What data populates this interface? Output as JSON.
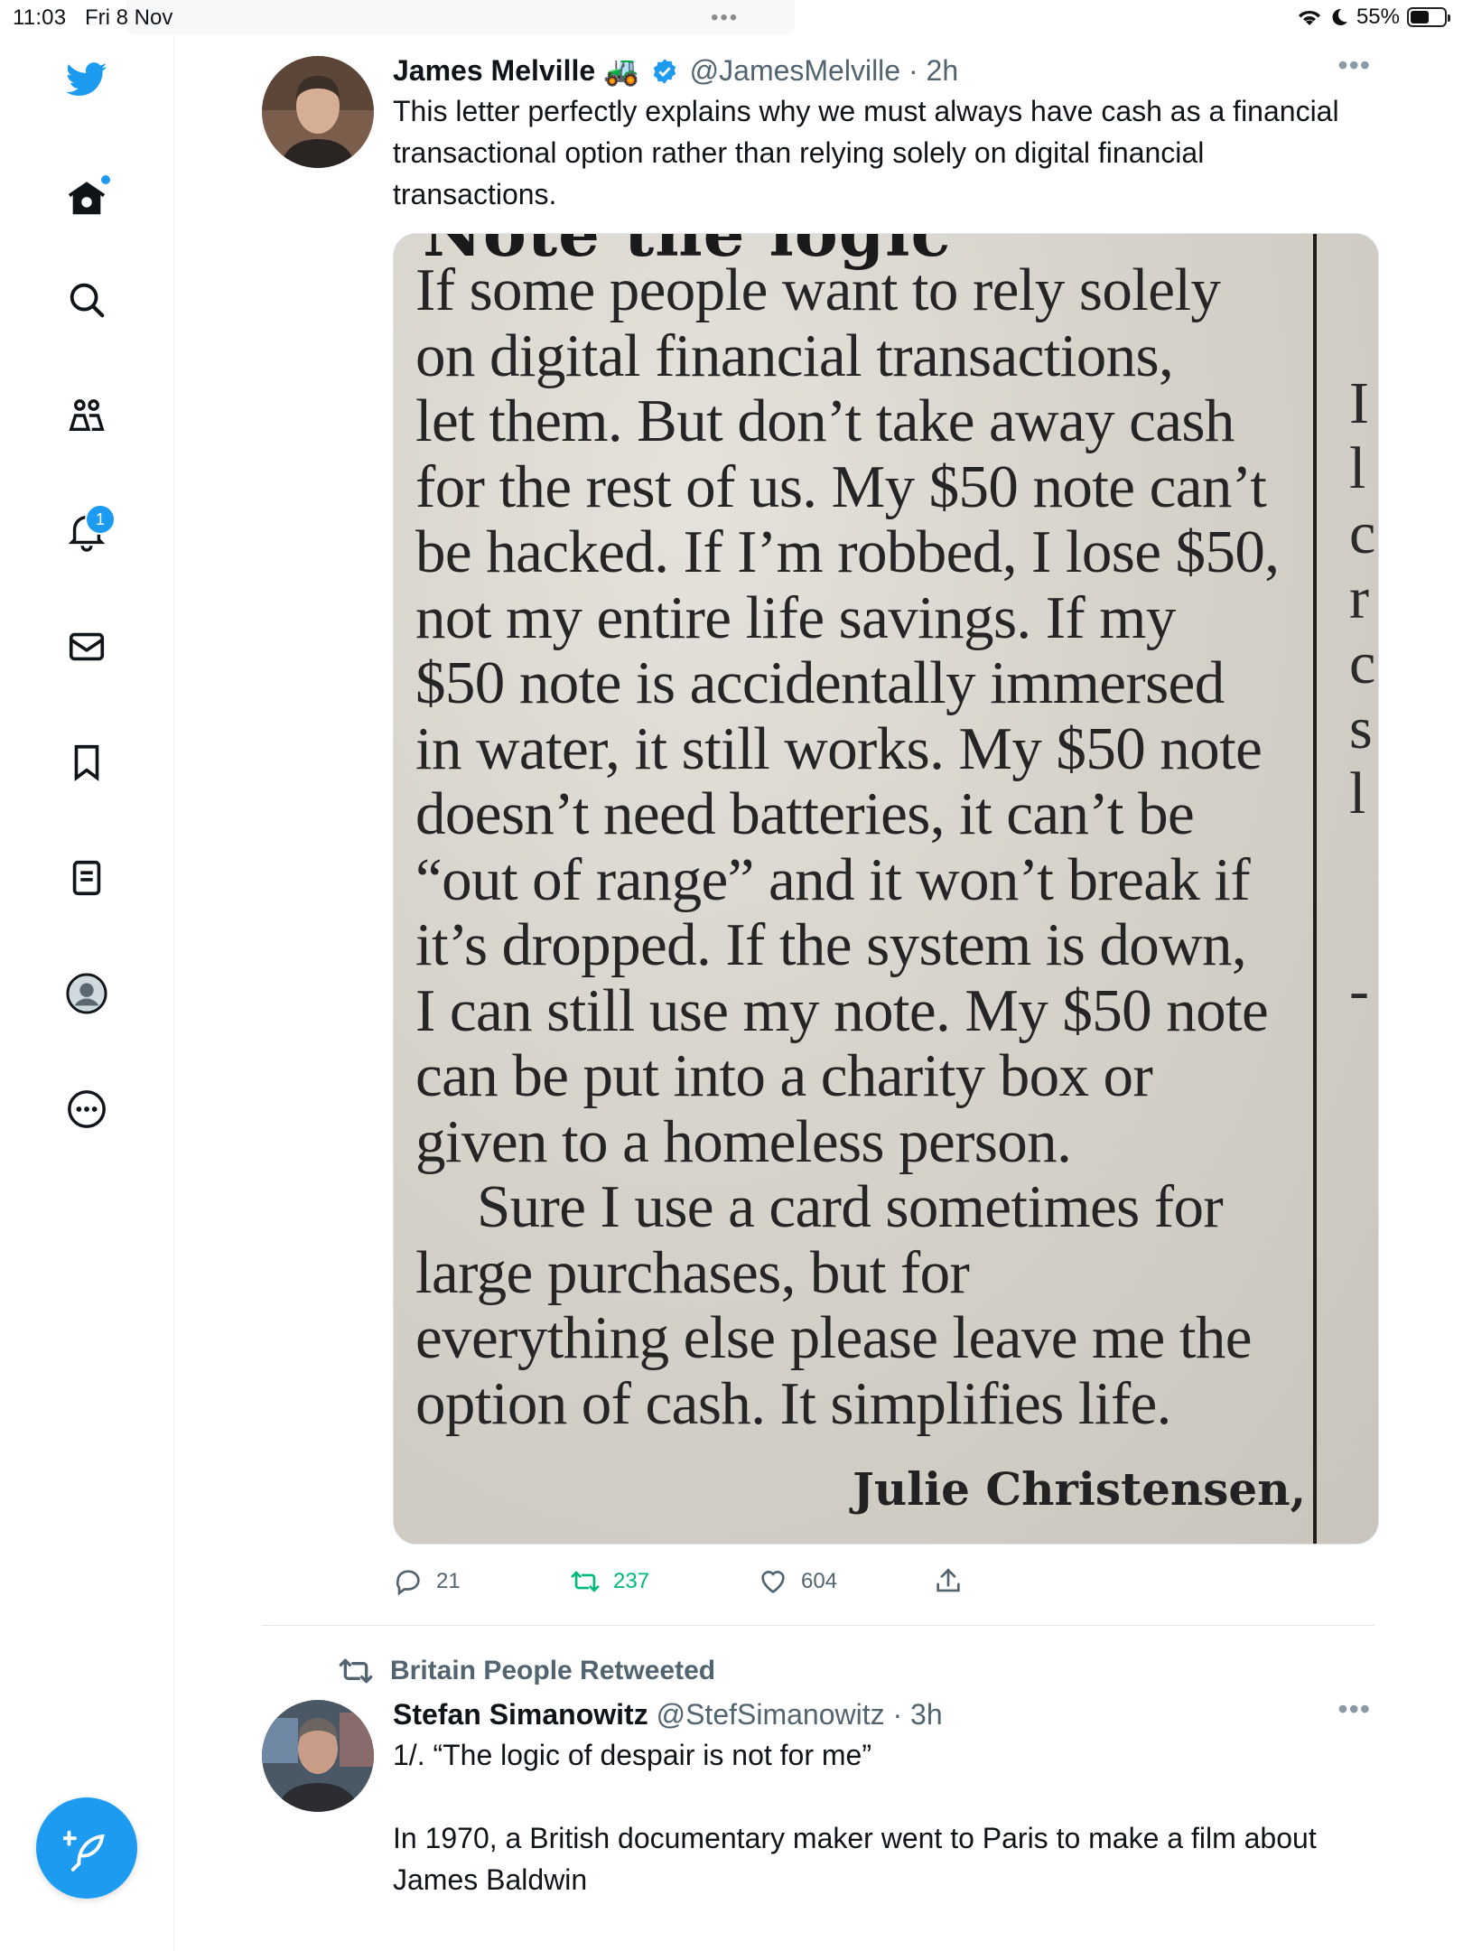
{
  "status_bar": {
    "time": "11:03",
    "date": "Fri 8 Nov",
    "battery_text": "55%",
    "battery_level": 0.55
  },
  "nav": {
    "notification_count": "1"
  },
  "tweet1": {
    "name": "James Melville",
    "name_emoji": "🚜",
    "handle": "@JamesMelville",
    "separator": "·",
    "time": "2h",
    "text": "This letter perfectly explains why we must always have cash as a financial transactional option rather than relying solely on digital financial transactions.",
    "image": {
      "heading": "Note the logic",
      "lines": [
        "If some people want to rely solely",
        "on digital financial transactions,",
        "let them. But don’t take away cash",
        "for the rest of us. My $50 note can’t",
        "be hacked. If I’m robbed, I lose $50,",
        "not my entire life savings. If my",
        "$50 note is accidentally immersed",
        "in water, it still works. My $50 note",
        "doesn’t need batteries, it can’t be",
        "“out of range” and it won’t break if",
        "it’s dropped. If the system is down,",
        "I can still use my note. My $50 note",
        "can be put into a charity box or",
        "given to a homeless person."
      ],
      "para2_lines": [
        "Sure I use a card sometimes for",
        "large purchases, but for",
        "everything else please leave me the",
        "option of cash. It simplifies life."
      ],
      "signature": "Julie Christensen,"
    },
    "replies": "21",
    "retweets": "237",
    "likes": "604"
  },
  "retweet_label": "Britain People Retweeted",
  "tweet2": {
    "name": "Stefan Simanowitz",
    "handle": "@StefSimanowitz",
    "separator": "·",
    "time": "3h",
    "text_line1": "1/. “The logic of despair is not for me”",
    "text_line2": "In 1970, a British documentary maker went to Paris to make a film about James Baldwin"
  }
}
